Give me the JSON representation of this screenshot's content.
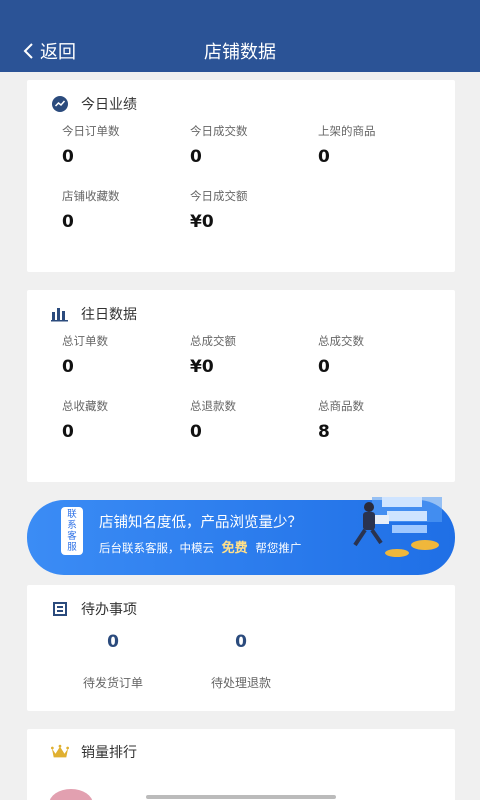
{
  "header": {
    "back_label": "返回",
    "title": "店铺数据"
  },
  "today": {
    "title": "今日业绩",
    "stats": [
      {
        "label": "今日订单数",
        "value": "0"
      },
      {
        "label": "今日成交数",
        "value": "0"
      },
      {
        "label": "上架的商品",
        "value": "0"
      },
      {
        "label": "店铺收藏数",
        "value": "0"
      },
      {
        "label": "今日成交额",
        "value": "¥0"
      }
    ]
  },
  "history": {
    "title": "往日数据",
    "stats": [
      {
        "label": "总订单数",
        "value": "0"
      },
      {
        "label": "总成交额",
        "value": "¥0"
      },
      {
        "label": "总成交数",
        "value": "0"
      },
      {
        "label": "总收藏数",
        "value": "0"
      },
      {
        "label": "总退款数",
        "value": "0"
      },
      {
        "label": "总商品数",
        "value": "8"
      }
    ]
  },
  "banner": {
    "badge": "联系客服",
    "headline": "店铺知名度低，产品浏览量少？",
    "line_prefix": "后台联系客服，中模云",
    "line_free": "免费",
    "line_suffix": "帮您推广"
  },
  "todo": {
    "title": "待办事项",
    "items": [
      {
        "label": "待发货订单",
        "value": "0"
      },
      {
        "label": "待处理退款",
        "value": "0"
      }
    ]
  },
  "ranking": {
    "title": "销量排行"
  },
  "colors": {
    "header": "#2b5396",
    "accent": "#2b4b7d",
    "banner": "#2f7ff0",
    "crown": "#e0b030"
  }
}
